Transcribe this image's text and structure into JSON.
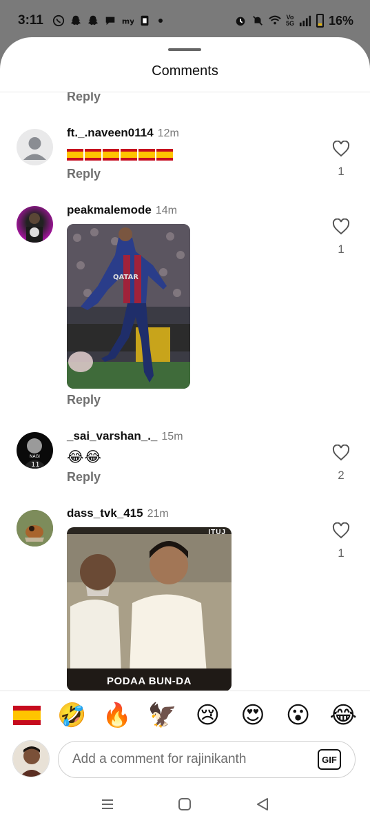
{
  "status_bar": {
    "time": "3:11",
    "battery": "16%",
    "battery_level": 0.16,
    "network_label_top": "Vo",
    "network_label_bottom": "5G",
    "notification_icons": [
      "whatsapp-icon",
      "snapchat-icon",
      "snapchat-icon",
      "chat-icon",
      "myjio-icon",
      "sim-icon"
    ]
  },
  "sheet": {
    "title": "Comments"
  },
  "reply_label": "Reply",
  "comments": [
    {
      "username": "ft._.naveen0114",
      "time": "12m",
      "text_flags": 6,
      "likes": "1",
      "avatar": "default-avatar"
    },
    {
      "username": "peakmalemode",
      "time": "14m",
      "likes": "1",
      "media": "gif-football-player"
    },
    {
      "username": "_sai_varshan_._",
      "time": "15m",
      "text": "😂😂",
      "likes": "2"
    },
    {
      "username": "dass_tvk_415",
      "time": "21m",
      "likes": "1",
      "media": "gif-two-men",
      "media_caption": "PODAA BUN-DA",
      "media_watermark": "ITUJ"
    }
  ],
  "reactions": [
    "spain-flag",
    "🤣",
    "🔥",
    "🦅",
    "😢",
    "😍",
    "😮",
    "😂"
  ],
  "composer": {
    "placeholder": "Add a comment for rajinikanth",
    "gif_label": "GIF"
  },
  "colors": {
    "like_outline": "#555555",
    "reply_text": "#6f6f6f",
    "spain_red": "#c60b1e",
    "spain_yellow": "#ffc400"
  }
}
